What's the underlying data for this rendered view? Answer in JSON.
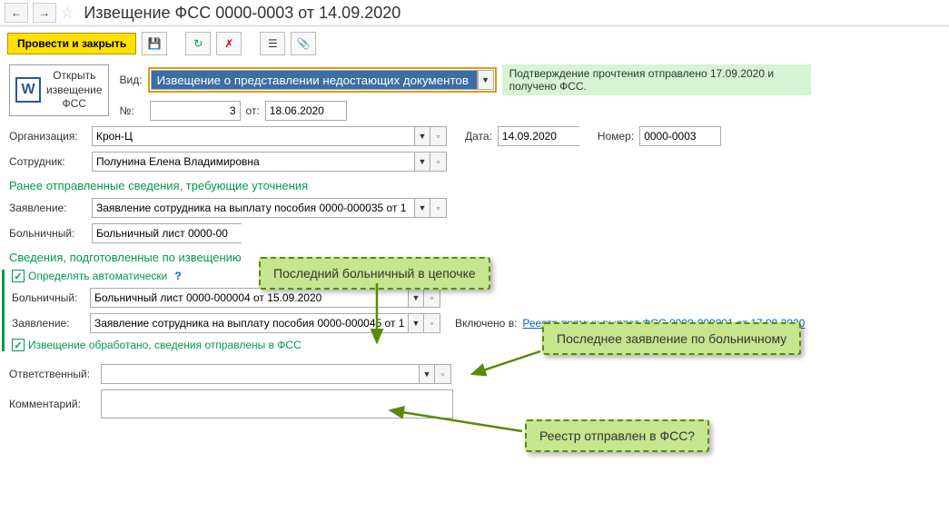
{
  "title": "Извещение ФСС 0000-0003 от 14.09.2020",
  "toolbar": {
    "post_close": "Провести и закрыть"
  },
  "word_btn": "Открыть\nизвещение\nФСС",
  "vid": {
    "label": "Вид:",
    "value": "Извещение о представлении недостающих документов"
  },
  "num": {
    "label": "№:",
    "value": "3",
    "from_label": "от:",
    "from_value": "18.06.2020"
  },
  "notice": "Подтверждение прочтения отправлено 17.09.2020 и получено ФСС.",
  "org": {
    "label": "Организация:",
    "value": "Крон-Ц"
  },
  "date": {
    "label": "Дата:",
    "value": "14.09.2020"
  },
  "number": {
    "label": "Номер:",
    "value": "0000-0003"
  },
  "employee": {
    "label": "Сотрудник:",
    "value": "Полунина Елена Владимировна"
  },
  "section1": "Ранее отправленные сведения, требующие уточнения",
  "app1": {
    "label": "Заявление:",
    "value": "Заявление сотрудника на выплату пособия 0000-000035 от 1"
  },
  "sick1": {
    "label": "Больничный:",
    "value": "Больничный лист 0000-00"
  },
  "section2": "Сведения, подготовленные по извещению",
  "auto_detect": "Определять автоматически",
  "sick2": {
    "label": "Больничный:",
    "value": "Больничный лист 0000-000004 от 15.09.2020"
  },
  "app2": {
    "label": "Заявление:",
    "value": "Заявление сотрудника на выплату пособия 0000-000045 от 1"
  },
  "included": {
    "label": "Включено в:",
    "link": "Реестр прямых выплат ФСС 0000-000001 от 17.09.2020"
  },
  "processed": "Извещение обработано, сведения отправлены в ФСС",
  "responsible": {
    "label": "Ответственный:",
    "value": ""
  },
  "comment": {
    "label": "Комментарий:",
    "value": ""
  },
  "callout1": "Последний больничный в цепочке",
  "callout2": "Последнее заявление по больничному",
  "callout3": "Реестр отправлен в ФСС?"
}
